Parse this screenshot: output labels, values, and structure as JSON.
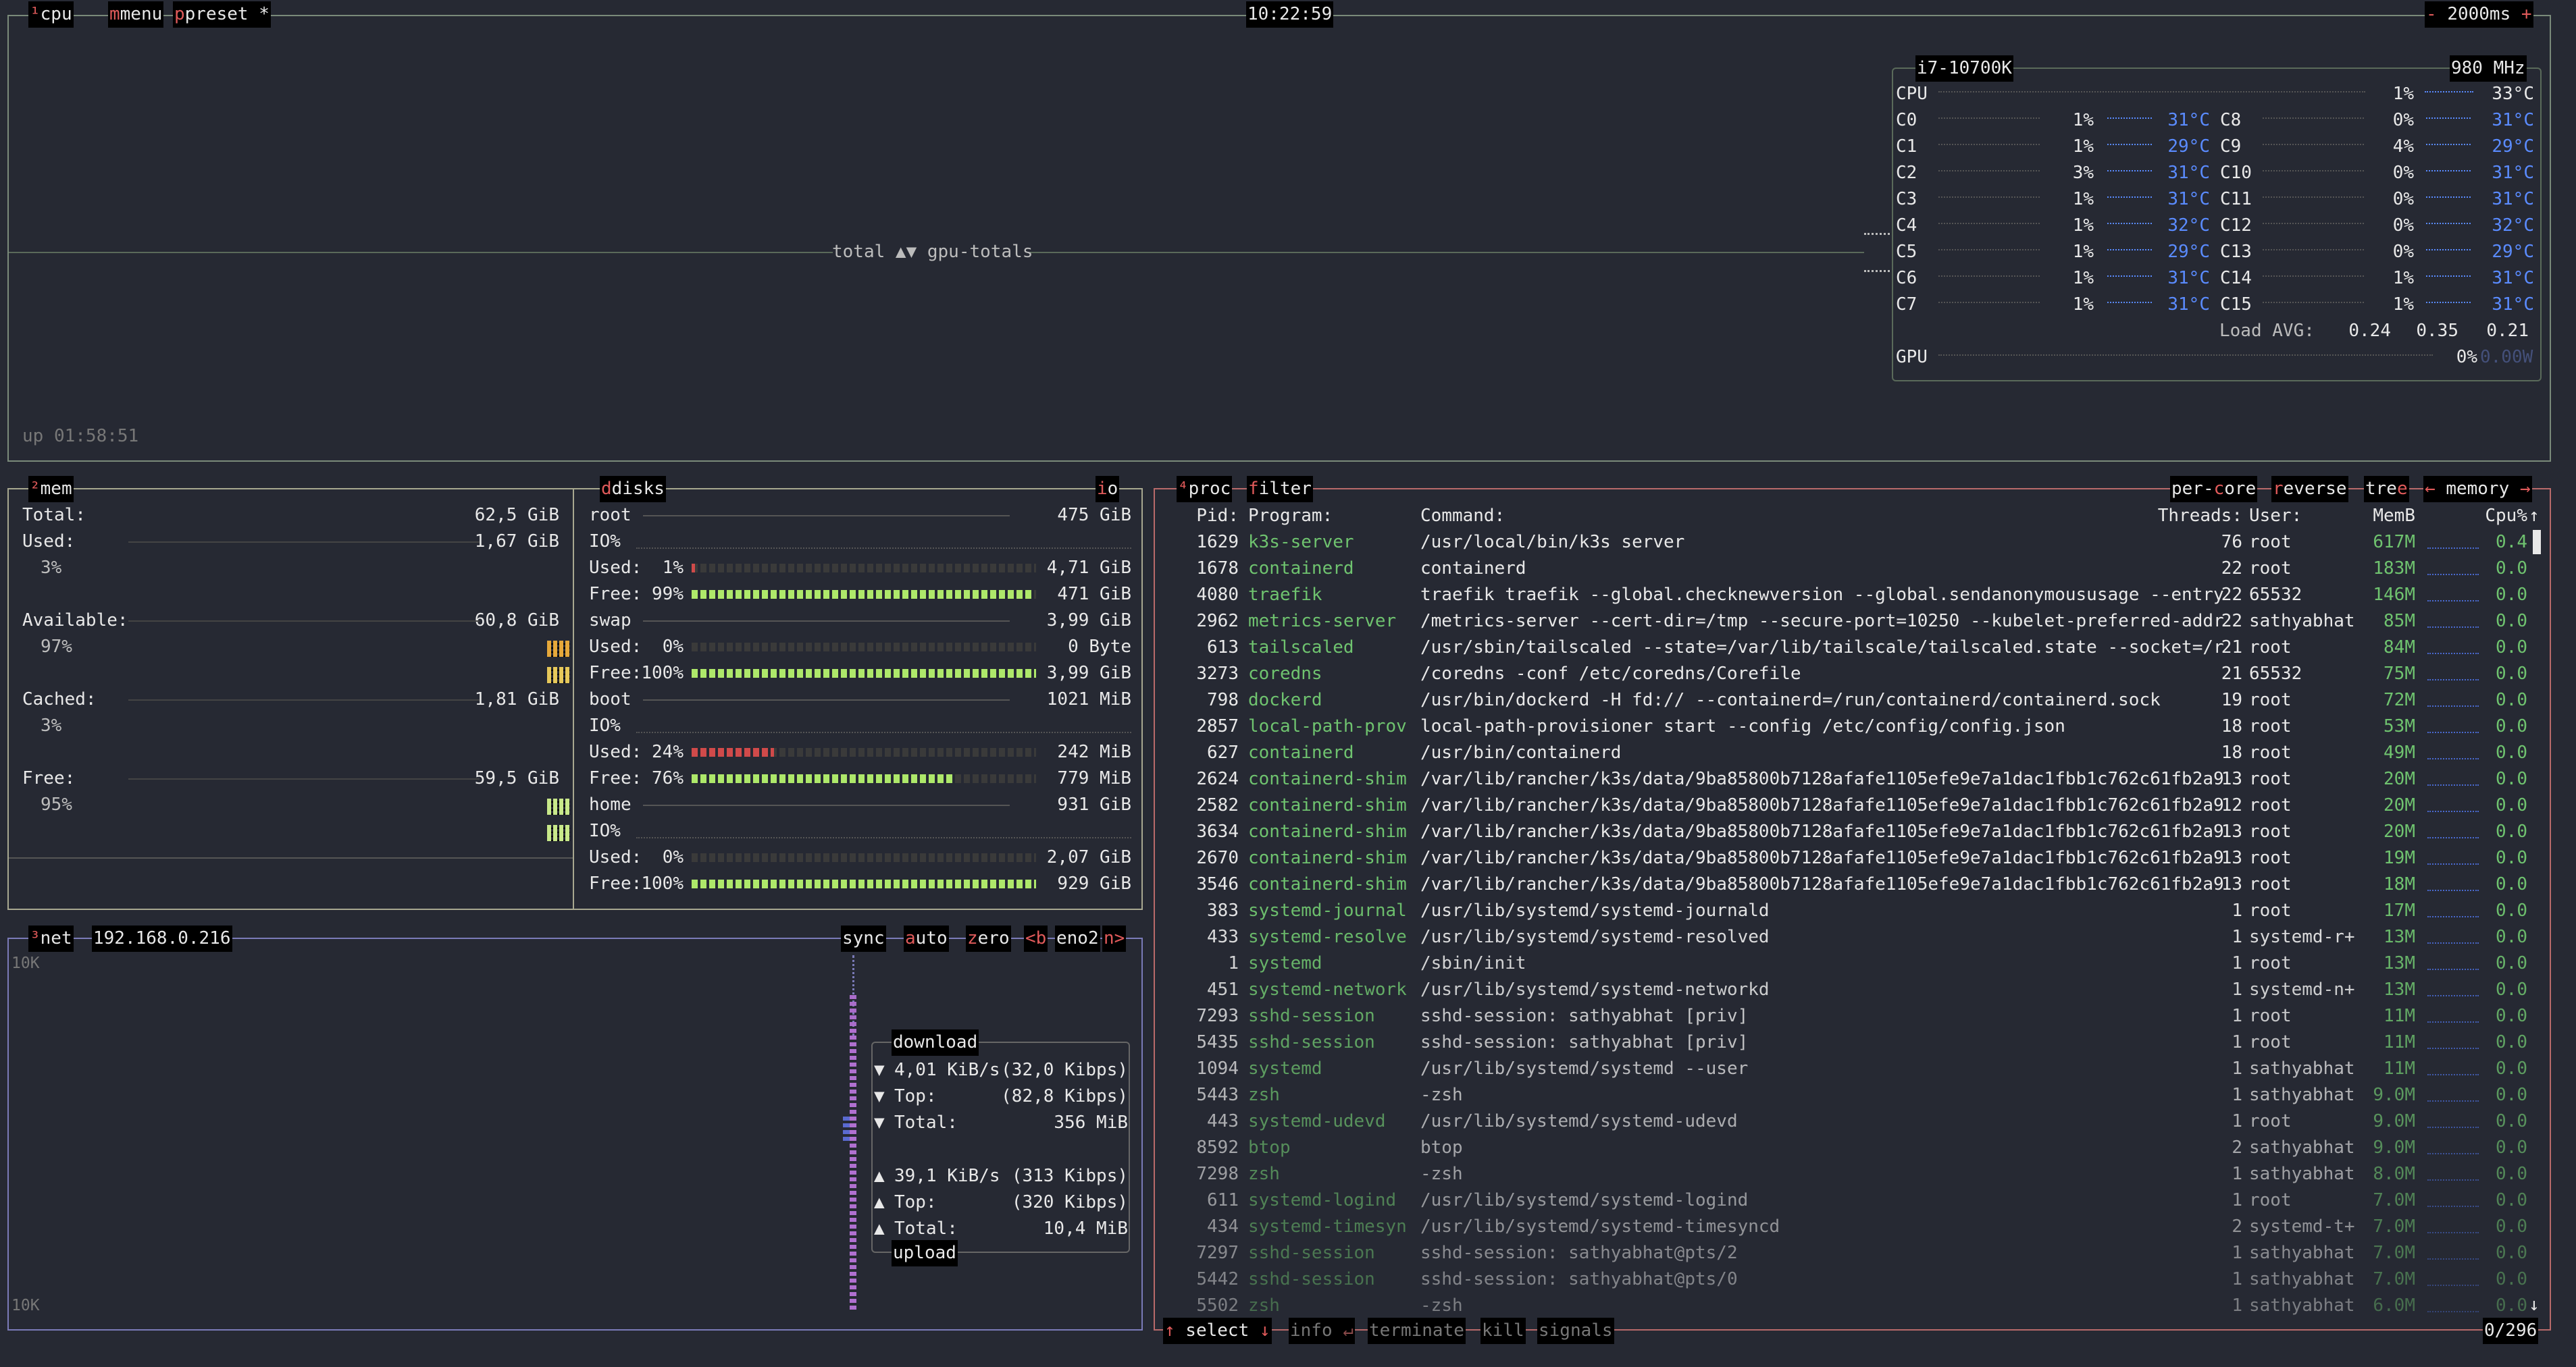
{
  "cpu_box": {
    "tab_cpu": "cpu",
    "tab_menu": "menu",
    "tab_preset": "preset *",
    "clock": "10:22:59",
    "minus": "-",
    "interval": "2000ms",
    "plus": "+",
    "graph_label": "total ▲▼ gpu-totals",
    "uptime": "up 01:58:51",
    "cpu_name": "i7-10700K",
    "freq": "980 MHz",
    "total": {
      "label": "CPU",
      "pct": "1%",
      "temp": "33°C",
      "load": 0.01
    },
    "cores_left": [
      {
        "label": "C0",
        "pct": "1%",
        "temp": "31°C"
      },
      {
        "label": "C1",
        "pct": "1%",
        "temp": "29°C"
      },
      {
        "label": "C2",
        "pct": "3%",
        "temp": "31°C"
      },
      {
        "label": "C3",
        "pct": "1%",
        "temp": "31°C"
      },
      {
        "label": "C4",
        "pct": "1%",
        "temp": "32°C"
      },
      {
        "label": "C5",
        "pct": "1%",
        "temp": "29°C"
      },
      {
        "label": "C6",
        "pct": "1%",
        "temp": "31°C"
      },
      {
        "label": "C7",
        "pct": "1%",
        "temp": "31°C"
      }
    ],
    "cores_right": [
      {
        "label": "C8",
        "pct": "0%",
        "temp": "31°C"
      },
      {
        "label": "C9",
        "pct": "4%",
        "temp": "29°C"
      },
      {
        "label": "C10",
        "pct": "0%",
        "temp": "31°C"
      },
      {
        "label": "C11",
        "pct": "0%",
        "temp": "31°C"
      },
      {
        "label": "C12",
        "pct": "0%",
        "temp": "32°C"
      },
      {
        "label": "C13",
        "pct": "0%",
        "temp": "29°C"
      },
      {
        "label": "C14",
        "pct": "1%",
        "temp": "31°C"
      },
      {
        "label": "C15",
        "pct": "1%",
        "temp": "31°C"
      }
    ],
    "load_avg_label": "Load AVG:",
    "load_avg": [
      "0.24",
      "0.35",
      "0.21"
    ],
    "gpu": {
      "label": "GPU",
      "pct": "0%",
      "watts": "0.00W"
    }
  },
  "mem_box": {
    "tab_mem": "mem",
    "rows": [
      {
        "label": "Total:",
        "value": "62,5 GiB"
      },
      {
        "label": "Used:",
        "value": "1,67 GiB",
        "pct": "3%"
      },
      {
        "label": "Available:",
        "value": "60,8 GiB",
        "pct": "97%"
      },
      {
        "label": "Cached:",
        "value": "1,81 GiB",
        "pct": "3%"
      },
      {
        "label": "Free:",
        "value": "59,5 GiB",
        "pct": "95%"
      }
    ]
  },
  "disks_box": {
    "tab_disks": "disks",
    "tab_io": "io",
    "disks": [
      {
        "name": "root",
        "size": "475 GiB",
        "io": "IO%",
        "used_label": "Used:",
        "used_pct": "1%",
        "used_fill": 0.01,
        "used_val": "4,71 GiB",
        "free_label": "Free:",
        "free_pct": "99%",
        "free_fill": 0.99,
        "free_val": "471 GiB"
      },
      {
        "name": "swap",
        "size": "3,99 GiB",
        "used_label": "Used:",
        "used_pct": "0%",
        "used_fill": 0.0,
        "used_val": "0 Byte",
        "free_label": "Free:",
        "free_pct": "100%",
        "free_fill": 1.0,
        "free_val": "3,99 GiB"
      },
      {
        "name": "boot",
        "size": "1021 MiB",
        "io": "IO%",
        "used_label": "Used:",
        "used_pct": "24%",
        "used_fill": 0.24,
        "used_val": "242 MiB",
        "free_label": "Free:",
        "free_pct": "76%",
        "free_fill": 0.76,
        "free_val": "779 MiB"
      },
      {
        "name": "home",
        "size": "931 GiB",
        "io": "IO%",
        "used_label": "Used:",
        "used_pct": "0%",
        "used_fill": 0.0,
        "used_val": "2,07 GiB",
        "free_label": "Free:",
        "free_pct": "100%",
        "free_fill": 1.0,
        "free_val": "929 GiB"
      }
    ]
  },
  "net_box": {
    "tab_net": "net",
    "ip": "192.168.0.216",
    "btn_sync": "sync",
    "btn_auto": "auto",
    "btn_zero": "zero",
    "btn_b": "<b",
    "iface": "eno2",
    "btn_n": "n>",
    "scale_top": "10K",
    "scale_bottom": "10K",
    "download_title": "download",
    "upload_title": "upload",
    "download": [
      {
        "arrow": "▼",
        "label": "4,01 KiB/s",
        "value": "(32,0 Kibps)"
      },
      {
        "arrow": "▼",
        "label": "Top:",
        "value": "(82,8 Kibps)"
      },
      {
        "arrow": "▼",
        "label": "Total:",
        "value": "356 MiB"
      }
    ],
    "upload": [
      {
        "arrow": "▲",
        "label": "39,1 KiB/s",
        "value": "(313 Kibps)"
      },
      {
        "arrow": "▲",
        "label": "Top:",
        "value": "(320 Kibps)"
      },
      {
        "arrow": "▲",
        "label": "Total:",
        "value": "10,4 MiB"
      }
    ]
  },
  "proc_box": {
    "tab_proc": "proc",
    "tab_filter": "filter",
    "tab_percore": "per-core",
    "tab_reverse": "reverse",
    "tab_tree": "tree",
    "tab_sort": "memory",
    "header": {
      "pid": "Pid:",
      "program": "Program:",
      "command": "Command:",
      "threads": "Threads:",
      "user": "User:",
      "mem": "MemB",
      "cpu": "Cpu%"
    },
    "rows": [
      {
        "pid": "1629",
        "program": "k3s-server",
        "command": "/usr/local/bin/k3s server",
        "threads": "76",
        "user": "root",
        "mem": "617M",
        "cpu": "0.4"
      },
      {
        "pid": "1678",
        "program": "containerd",
        "command": "containerd",
        "threads": "22",
        "user": "root",
        "mem": "183M",
        "cpu": "0.0"
      },
      {
        "pid": "4080",
        "program": "traefik",
        "command": "traefik traefik --global.checknewversion --global.sendanonymoususage --entry",
        "threads": "22",
        "user": "65532",
        "mem": "146M",
        "cpu": "0.0"
      },
      {
        "pid": "2962",
        "program": "metrics-server",
        "command": "/metrics-server --cert-dir=/tmp --secure-port=10250 --kubelet-preferred-addr",
        "threads": "22",
        "user": "sathyabhat",
        "mem": "85M",
        "cpu": "0.0"
      },
      {
        "pid": "613",
        "program": "tailscaled",
        "command": "/usr/sbin/tailscaled --state=/var/lib/tailscale/tailscaled.state --socket=/r",
        "threads": "21",
        "user": "root",
        "mem": "84M",
        "cpu": "0.0"
      },
      {
        "pid": "3273",
        "program": "coredns",
        "command": "/coredns -conf /etc/coredns/Corefile",
        "threads": "21",
        "user": "65532",
        "mem": "75M",
        "cpu": "0.0"
      },
      {
        "pid": "798",
        "program": "dockerd",
        "command": "/usr/bin/dockerd -H fd:// --containerd=/run/containerd/containerd.sock",
        "threads": "19",
        "user": "root",
        "mem": "72M",
        "cpu": "0.0"
      },
      {
        "pid": "2857",
        "program": "local-path-prov",
        "command": "local-path-provisioner start --config /etc/config/config.json",
        "threads": "18",
        "user": "root",
        "mem": "53M",
        "cpu": "0.0"
      },
      {
        "pid": "627",
        "program": "containerd",
        "command": "/usr/bin/containerd",
        "threads": "18",
        "user": "root",
        "mem": "49M",
        "cpu": "0.0"
      },
      {
        "pid": "2624",
        "program": "containerd-shim",
        "command": "/var/lib/rancher/k3s/data/9ba85800b7128afafe1105efe9e7a1dac1fbb1c762c61fb2a9",
        "threads": "13",
        "user": "root",
        "mem": "20M",
        "cpu": "0.0"
      },
      {
        "pid": "2582",
        "program": "containerd-shim",
        "command": "/var/lib/rancher/k3s/data/9ba85800b7128afafe1105efe9e7a1dac1fbb1c762c61fb2a9",
        "threads": "12",
        "user": "root",
        "mem": "20M",
        "cpu": "0.0"
      },
      {
        "pid": "3634",
        "program": "containerd-shim",
        "command": "/var/lib/rancher/k3s/data/9ba85800b7128afafe1105efe9e7a1dac1fbb1c762c61fb2a9",
        "threads": "13",
        "user": "root",
        "mem": "20M",
        "cpu": "0.0"
      },
      {
        "pid": "2670",
        "program": "containerd-shim",
        "command": "/var/lib/rancher/k3s/data/9ba85800b7128afafe1105efe9e7a1dac1fbb1c762c61fb2a9",
        "threads": "13",
        "user": "root",
        "mem": "19M",
        "cpu": "0.0"
      },
      {
        "pid": "3546",
        "program": "containerd-shim",
        "command": "/var/lib/rancher/k3s/data/9ba85800b7128afafe1105efe9e7a1dac1fbb1c762c61fb2a9",
        "threads": "13",
        "user": "root",
        "mem": "18M",
        "cpu": "0.0"
      },
      {
        "pid": "383",
        "program": "systemd-journal",
        "command": "/usr/lib/systemd/systemd-journald",
        "threads": "1",
        "user": "root",
        "mem": "17M",
        "cpu": "0.0"
      },
      {
        "pid": "433",
        "program": "systemd-resolve",
        "command": "/usr/lib/systemd/systemd-resolved",
        "threads": "1",
        "user": "systemd-r+",
        "mem": "13M",
        "cpu": "0.0"
      },
      {
        "pid": "1",
        "program": "systemd",
        "command": "/sbin/init",
        "threads": "1",
        "user": "root",
        "mem": "13M",
        "cpu": "0.0"
      },
      {
        "pid": "451",
        "program": "systemd-network",
        "command": "/usr/lib/systemd/systemd-networkd",
        "threads": "1",
        "user": "systemd-n+",
        "mem": "13M",
        "cpu": "0.0"
      },
      {
        "pid": "7293",
        "program": "sshd-session",
        "command": "sshd-session: sathyabhat [priv]",
        "threads": "1",
        "user": "root",
        "mem": "11M",
        "cpu": "0.0"
      },
      {
        "pid": "5435",
        "program": "sshd-session",
        "command": "sshd-session: sathyabhat [priv]",
        "threads": "1",
        "user": "root",
        "mem": "11M",
        "cpu": "0.0"
      },
      {
        "pid": "1094",
        "program": "systemd",
        "command": "/usr/lib/systemd/systemd --user",
        "threads": "1",
        "user": "sathyabhat",
        "mem": "11M",
        "cpu": "0.0"
      },
      {
        "pid": "5443",
        "program": "zsh",
        "command": "-zsh",
        "threads": "1",
        "user": "sathyabhat",
        "mem": "9.0M",
        "cpu": "0.0"
      },
      {
        "pid": "443",
        "program": "systemd-udevd",
        "command": "/usr/lib/systemd/systemd-udevd",
        "threads": "1",
        "user": "root",
        "mem": "9.0M",
        "cpu": "0.0"
      },
      {
        "pid": "8592",
        "program": "btop",
        "command": "btop",
        "threads": "2",
        "user": "sathyabhat",
        "mem": "9.0M",
        "cpu": "0.0"
      },
      {
        "pid": "7298",
        "program": "zsh",
        "command": "-zsh",
        "threads": "1",
        "user": "sathyabhat",
        "mem": "8.0M",
        "cpu": "0.0"
      },
      {
        "pid": "611",
        "program": "systemd-logind",
        "command": "/usr/lib/systemd/systemd-logind",
        "threads": "1",
        "user": "root",
        "mem": "7.0M",
        "cpu": "0.0"
      },
      {
        "pid": "434",
        "program": "systemd-timesyn",
        "command": "/usr/lib/systemd/systemd-timesyncd",
        "threads": "2",
        "user": "systemd-t+",
        "mem": "7.0M",
        "cpu": "0.0"
      },
      {
        "pid": "7297",
        "program": "sshd-session",
        "command": "sshd-session: sathyabhat@pts/2",
        "threads": "1",
        "user": "sathyabhat",
        "mem": "7.0M",
        "cpu": "0.0"
      },
      {
        "pid": "5442",
        "program": "sshd-session",
        "command": "sshd-session: sathyabhat@pts/0",
        "threads": "1",
        "user": "sathyabhat",
        "mem": "7.0M",
        "cpu": "0.0"
      },
      {
        "pid": "5502",
        "program": "zsh",
        "command": "-zsh",
        "threads": "1",
        "user": "sathyabhat",
        "mem": "6.0M",
        "cpu": "0.0"
      }
    ],
    "footer": {
      "select": "↑ select ↓",
      "info": "info ↵",
      "terminate": "terminate",
      "kill": "kill",
      "signals": "signals",
      "count": "0/296"
    }
  },
  "colors": {
    "cpu_border": "#7a8a7a",
    "mem_border": "#a8a890",
    "net_border": "#7a7ab8",
    "proc_border": "#b86a6a",
    "hotkey": "#e05a5a",
    "program": "#6fc36f",
    "temp_blue": "#5a8bff"
  }
}
